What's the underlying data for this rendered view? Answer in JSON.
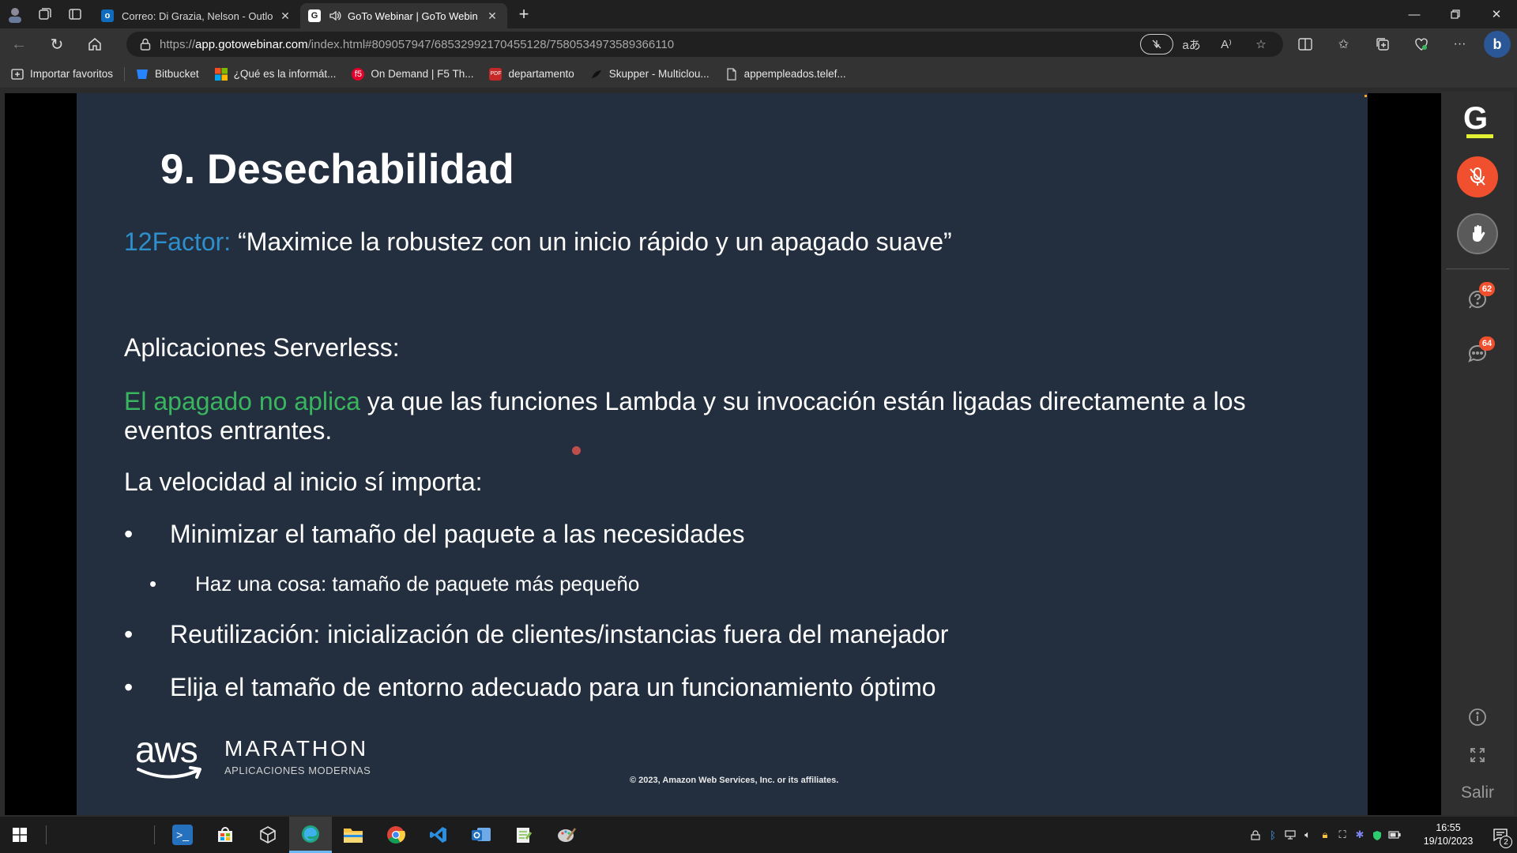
{
  "browser": {
    "tabs": [
      {
        "title": "Correo: Di Grazia, Nelson - Outlo",
        "favicon": "outlook-icon",
        "favicon_color": "#0f6cbd",
        "active": false
      },
      {
        "title": "GoTo Webinar | GoTo Webin",
        "favicon": "goto-icon",
        "favicon_color": "#ffffff",
        "active": true,
        "audio": true
      }
    ],
    "url": {
      "scheme": "https://",
      "host": "app.gotowebinar.com",
      "path": "/index.html#809057947/6853299217045512​8/7580534973589366110"
    },
    "bookmarks": [
      {
        "label": "Importar favoritos",
        "icon": "import-icon"
      },
      {
        "label": "Bitbucket",
        "icon": "bitbucket-icon",
        "color": "#2684ff"
      },
      {
        "label": "¿Qué es la informát...",
        "icon": "microsoft-icon",
        "color": "#f25022"
      },
      {
        "label": "On Demand | F5 Th...",
        "icon": "f5-icon",
        "color": "#e4002b"
      },
      {
        "label": "departamento",
        "icon": "pdf-icon",
        "color": "#c62828"
      },
      {
        "label": "Skupper - Multiclou...",
        "icon": "skupper-icon",
        "color": "#333333"
      },
      {
        "label": "appempleados.telef...",
        "icon": "page-icon",
        "color": "#cccccc"
      }
    ]
  },
  "slide": {
    "title": "9. Desechabilidad",
    "quote_prefix": "12Factor:",
    "quote": " “Maximice la robustez con un inicio rápido y un apagado suave”",
    "serverless_heading": "Aplicaciones Serverless:",
    "shutdown_highlight": "El apagado no aplica",
    "shutdown_rest": " ya que las funciones Lambda y su invocación están ligadas directamente a los eventos entrantes.",
    "startup_heading": "La velocidad al inicio sí importa:",
    "bullets": [
      {
        "text": "Minimizar el tamaño del paquete a las necesidades",
        "level": 1
      },
      {
        "text": "Haz una cosa: tamaño de paquete más pequeño",
        "level": 2
      },
      {
        "text": "Reutilización: inicialización de clientes/instancias fuera del manejador",
        "level": 1
      },
      {
        "text": "Elija el tamaño de entorno adecuado para un funcionamiento óptimo",
        "level": 1
      }
    ],
    "bullet_char": "•",
    "logo_aws": "aws",
    "logo_marathon": "MARATHON",
    "logo_marathon_sub": "APLICACIONES MODERNAS",
    "copyright": "© 2023, Amazon Web Services, Inc. or its affiliates.",
    "colors": {
      "background": "#232f3e",
      "blue": "#2d8fcc",
      "orange": "#f5a623",
      "green": "#3ab55f"
    }
  },
  "goto_sidebar": {
    "logo": "G",
    "qa_count": "62",
    "chat_count": "64",
    "exit_label": "Salir",
    "accent": "#f0502e"
  },
  "taskbar": {
    "time": "16:55",
    "date": "19/10/2023",
    "notifications": "2",
    "apps": [
      {
        "name": "powershell-icon",
        "color": "#2671be"
      },
      {
        "name": "store-icon",
        "color": "#f0f0f0"
      },
      {
        "name": "virtualbox-icon",
        "color": "#dcdcdc"
      },
      {
        "name": "edge-icon",
        "color": "#1fa37f",
        "active": true
      },
      {
        "name": "file-explorer-icon",
        "color": "#f6c343"
      },
      {
        "name": "chrome-icon",
        "color": "#db4437"
      },
      {
        "name": "vscode-icon",
        "color": "#2a8fe0"
      },
      {
        "name": "outlook-desktop-icon",
        "color": "#1f6fc0"
      },
      {
        "name": "notepad-plus-icon",
        "color": "#7cbf4a"
      },
      {
        "name": "paint-icon",
        "color": "#d0d0d0"
      }
    ]
  }
}
